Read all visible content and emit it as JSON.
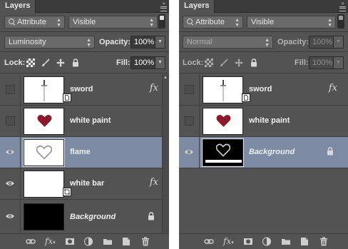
{
  "colors": {
    "panel_bg": "#535353",
    "selected_row": "#7d8aa3",
    "text": "#e6e6e6"
  },
  "panels": [
    {
      "tab_title": "Layers",
      "filter": {
        "kind": "Attribute",
        "value": "Visible"
      },
      "blend_mode": "Luminosity",
      "opacity_label": "Opacity:",
      "opacity": "100%",
      "lock_label": "Lock:",
      "fill_label": "Fill:",
      "fill": "100%",
      "layers": [
        {
          "name": "sword",
          "visible": false,
          "has_fx": true,
          "thumb": "sword",
          "selected": false
        },
        {
          "name": "white paint",
          "visible": false,
          "has_fx": false,
          "thumb": "red-heart",
          "selected": false
        },
        {
          "name": "flame",
          "visible": true,
          "has_fx": false,
          "thumb": "outline-heart",
          "selected": true
        },
        {
          "name": "white bar",
          "visible": true,
          "has_fx": true,
          "thumb": "white-bar",
          "selected": false
        },
        {
          "name": "Background",
          "visible": true,
          "has_fx": false,
          "thumb": "black",
          "selected": false,
          "locked": true
        }
      ],
      "bottom_icons": [
        "link-layers-icon",
        "fx-icon",
        "add-mask-icon",
        "adjustment-layer-icon",
        "new-group-icon",
        "new-layer-icon",
        "delete-layer-icon"
      ]
    },
    {
      "tab_title": "Layers",
      "filter": {
        "kind": "Attribute",
        "value": "Visible"
      },
      "blend_mode": "Normal",
      "opacity_label": "Opacity:",
      "opacity": "100%",
      "lock_label": "Lock:",
      "fill_label": "Fill:",
      "fill": "100%",
      "layers": [
        {
          "name": "sword",
          "visible": false,
          "has_fx": true,
          "thumb": "sword",
          "selected": false
        },
        {
          "name": "white paint",
          "visible": false,
          "has_fx": false,
          "thumb": "red-heart",
          "selected": false
        },
        {
          "name": "Background",
          "visible": true,
          "has_fx": false,
          "thumb": "black-heart",
          "selected": true,
          "locked": true
        }
      ],
      "bottom_icons": [
        "link-layers-icon",
        "fx-icon",
        "add-mask-icon",
        "adjustment-layer-icon",
        "new-group-icon",
        "new-layer-icon",
        "delete-layer-icon"
      ]
    }
  ]
}
